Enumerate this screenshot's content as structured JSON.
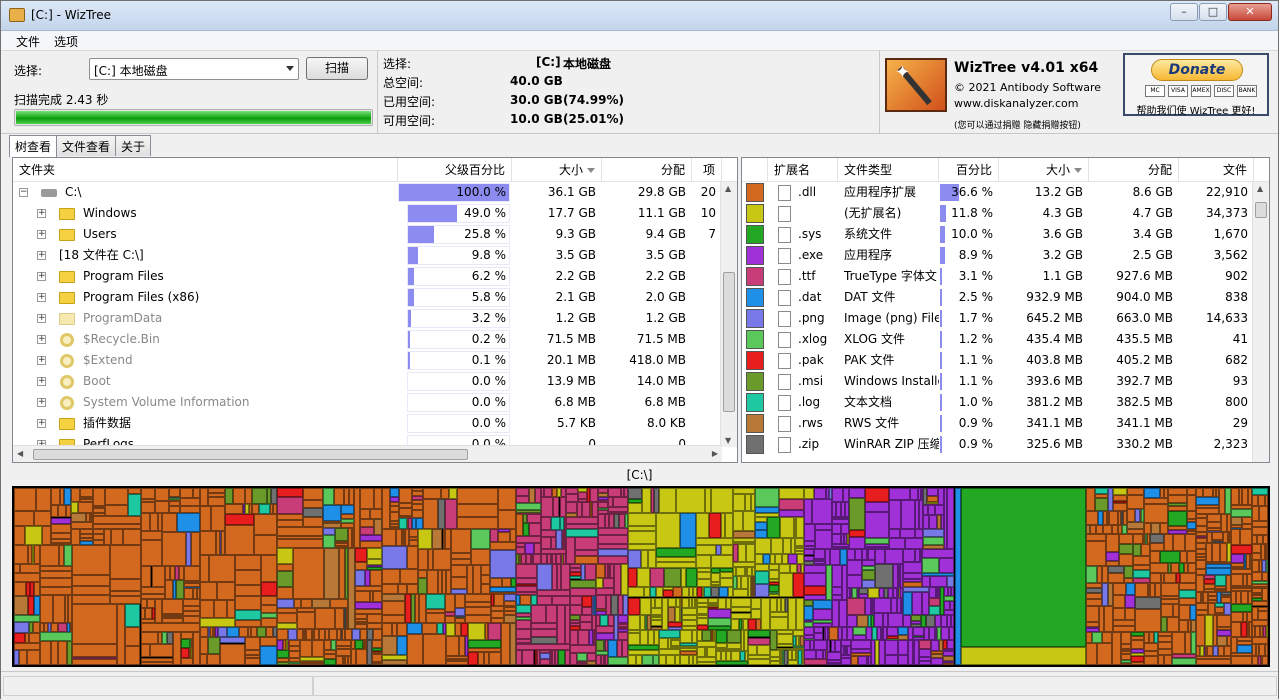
{
  "window": {
    "title": "[C:]  - WizTree"
  },
  "menu": {
    "file": "文件",
    "options": "选项"
  },
  "scan": {
    "select_label": "选择:",
    "drive_value": "[C:] 本地磁盘",
    "scan_button": "扫描",
    "status": "扫描完成 2.43 秒",
    "progress_fraction": 1.0
  },
  "summary": {
    "select_label": "选择:",
    "drive_code": "[C:]",
    "drive_name": "本地磁盘",
    "total_label": "总空间:",
    "total_value": "40.0 GB",
    "used_label": "已用空间:",
    "used_value": "30.0 GB",
    "used_pct": "(74.99%)",
    "free_label": "可用空间:",
    "free_value": "10.0 GB",
    "free_pct": "(25.01%)"
  },
  "brand": {
    "product": "WizTree v4.01 x64",
    "copyright": "© 2021 Antibody Software",
    "website": "www.diskanalyzer.com",
    "hide_hint": "(您可以通过捐赠 隐藏捐赠按钮)",
    "donate_label": "Donate",
    "donate_note": "帮助我们使 WizTree 更好!",
    "cards": [
      "MC",
      "VISA",
      "AMEX",
      "DISC",
      "BANK"
    ]
  },
  "tabs": [
    "树查看",
    "文件查看",
    "关于"
  ],
  "tree": {
    "headers": {
      "folder": "文件夹",
      "parent_pct": "父级百分比",
      "size": "大小",
      "alloc": "分配",
      "items": "项"
    },
    "rows": [
      {
        "name": "C:\\",
        "icon": "drive",
        "pct": 100.0,
        "pct_text": "100.0 %",
        "size": "36.1 GB",
        "alloc": "29.8 GB",
        "items": "20",
        "faded": false,
        "level": 0
      },
      {
        "name": "Windows",
        "icon": "folder",
        "pct": 49.0,
        "pct_text": "49.0 %",
        "size": "17.7 GB",
        "alloc": "11.1 GB",
        "items": "10",
        "faded": false,
        "level": 1
      },
      {
        "name": "Users",
        "icon": "folder",
        "pct": 25.8,
        "pct_text": "25.8 %",
        "size": "9.3 GB",
        "alloc": "9.4 GB",
        "items": "7",
        "faded": false,
        "level": 1
      },
      {
        "name": "[18 文件在 C:\\]",
        "icon": "none",
        "pct": 9.8,
        "pct_text": "9.8 %",
        "size": "3.5 GB",
        "alloc": "3.5 GB",
        "items": "",
        "faded": false,
        "level": 1
      },
      {
        "name": "Program Files",
        "icon": "folder",
        "pct": 6.2,
        "pct_text": "6.2 %",
        "size": "2.2 GB",
        "alloc": "2.2 GB",
        "items": "",
        "faded": false,
        "level": 1
      },
      {
        "name": "Program Files (x86)",
        "icon": "folder",
        "pct": 5.8,
        "pct_text": "5.8 %",
        "size": "2.1 GB",
        "alloc": "2.0 GB",
        "items": "",
        "faded": false,
        "level": 1
      },
      {
        "name": "ProgramData",
        "icon": "folder-faded",
        "pct": 3.2,
        "pct_text": "3.2 %",
        "size": "1.2 GB",
        "alloc": "1.2 GB",
        "items": "",
        "faded": true,
        "level": 1
      },
      {
        "name": "$Recycle.Bin",
        "icon": "gear",
        "pct": 0.2,
        "pct_text": "0.2 %",
        "size": "71.5 MB",
        "alloc": "71.5 MB",
        "items": "",
        "faded": true,
        "level": 1
      },
      {
        "name": "$Extend",
        "icon": "gear",
        "pct": 0.1,
        "pct_text": "0.1 %",
        "size": "20.1 MB",
        "alloc": "418.0 MB",
        "items": "",
        "faded": true,
        "level": 1
      },
      {
        "name": "Boot",
        "icon": "gear",
        "pct": 0.0,
        "pct_text": "0.0 %",
        "size": "13.9 MB",
        "alloc": "14.0 MB",
        "items": "",
        "faded": true,
        "level": 1
      },
      {
        "name": "System Volume Information",
        "icon": "gear",
        "pct": 0.0,
        "pct_text": "0.0 %",
        "size": "6.8 MB",
        "alloc": "6.8 MB",
        "items": "",
        "faded": true,
        "level": 1
      },
      {
        "name": "插件数据",
        "icon": "folder",
        "pct": 0.0,
        "pct_text": "0.0 %",
        "size": "5.7 KB",
        "alloc": "8.0 KB",
        "items": "",
        "faded": false,
        "level": 1
      },
      {
        "name": "PerfLogs",
        "icon": "folder",
        "pct": 0.0,
        "pct_text": "0.0 %",
        "size": "0",
        "alloc": "0",
        "items": "",
        "faded": false,
        "level": 1
      }
    ]
  },
  "types": {
    "headers": {
      "ext": "扩展名",
      "type": "文件类型",
      "pct": "百分比",
      "size": "大小",
      "alloc": "分配",
      "files": "文件"
    },
    "rows": [
      {
        "color": "#d2691e",
        "ext": ".dll",
        "type": "应用程序扩展",
        "pct": 36.6,
        "pct_text": "36.6 %",
        "size": "13.2 GB",
        "alloc": "8.6 GB",
        "files": "22,910"
      },
      {
        "color": "#c8c814",
        "ext": "",
        "type": "(无扩展名)",
        "pct": 11.8,
        "pct_text": "11.8 %",
        "size": "4.3 GB",
        "alloc": "4.7 GB",
        "files": "34,373"
      },
      {
        "color": "#22a822",
        "ext": ".sys",
        "type": "系统文件",
        "pct": 10.0,
        "pct_text": "10.0 %",
        "size": "3.6 GB",
        "alloc": "3.4 GB",
        "files": "1,670"
      },
      {
        "color": "#a030d8",
        "ext": ".exe",
        "type": "应用程序",
        "pct": 8.9,
        "pct_text": "8.9 %",
        "size": "3.2 GB",
        "alloc": "2.5 GB",
        "files": "3,562"
      },
      {
        "color": "#c83c78",
        "ext": ".ttf",
        "type": "TrueType 字体文",
        "pct": 3.1,
        "pct_text": "3.1 %",
        "size": "1.1 GB",
        "alloc": "927.6 MB",
        "files": "902"
      },
      {
        "color": "#1e90e8",
        "ext": ".dat",
        "type": "DAT 文件",
        "pct": 2.5,
        "pct_text": "2.5 %",
        "size": "932.9 MB",
        "alloc": "904.0 MB",
        "files": "838"
      },
      {
        "color": "#7878e8",
        "ext": ".png",
        "type": "Image (png) File",
        "pct": 1.7,
        "pct_text": "1.7 %",
        "size": "645.2 MB",
        "alloc": "663.0 MB",
        "files": "14,633"
      },
      {
        "color": "#5ac85a",
        "ext": ".xlog",
        "type": "XLOG 文件",
        "pct": 1.2,
        "pct_text": "1.2 %",
        "size": "435.4 MB",
        "alloc": "435.5 MB",
        "files": "41"
      },
      {
        "color": "#e81e1e",
        "ext": ".pak",
        "type": "PAK 文件",
        "pct": 1.1,
        "pct_text": "1.1 %",
        "size": "403.8 MB",
        "alloc": "405.2 MB",
        "files": "682"
      },
      {
        "color": "#6a9a2a",
        "ext": ".msi",
        "type": "Windows Installe",
        "pct": 1.1,
        "pct_text": "1.1 %",
        "size": "393.6 MB",
        "alloc": "392.7 MB",
        "files": "93"
      },
      {
        "color": "#1ec8a0",
        "ext": ".log",
        "type": "文本文档",
        "pct": 1.0,
        "pct_text": "1.0 %",
        "size": "381.2 MB",
        "alloc": "382.5 MB",
        "files": "800"
      },
      {
        "color": "#b87838",
        "ext": ".rws",
        "type": "RWS 文件",
        "pct": 0.9,
        "pct_text": "0.9 %",
        "size": "341.1 MB",
        "alloc": "341.1 MB",
        "files": "29"
      },
      {
        "color": "#707070",
        "ext": ".zip",
        "type": "WinRAR ZIP 压缩",
        "pct": 0.9,
        "pct_text": "0.9 %",
        "size": "325.6 MB",
        "alloc": "330.2 MB",
        "files": "2,323"
      }
    ]
  },
  "treemap": {
    "path_label": "[C:\\]"
  }
}
